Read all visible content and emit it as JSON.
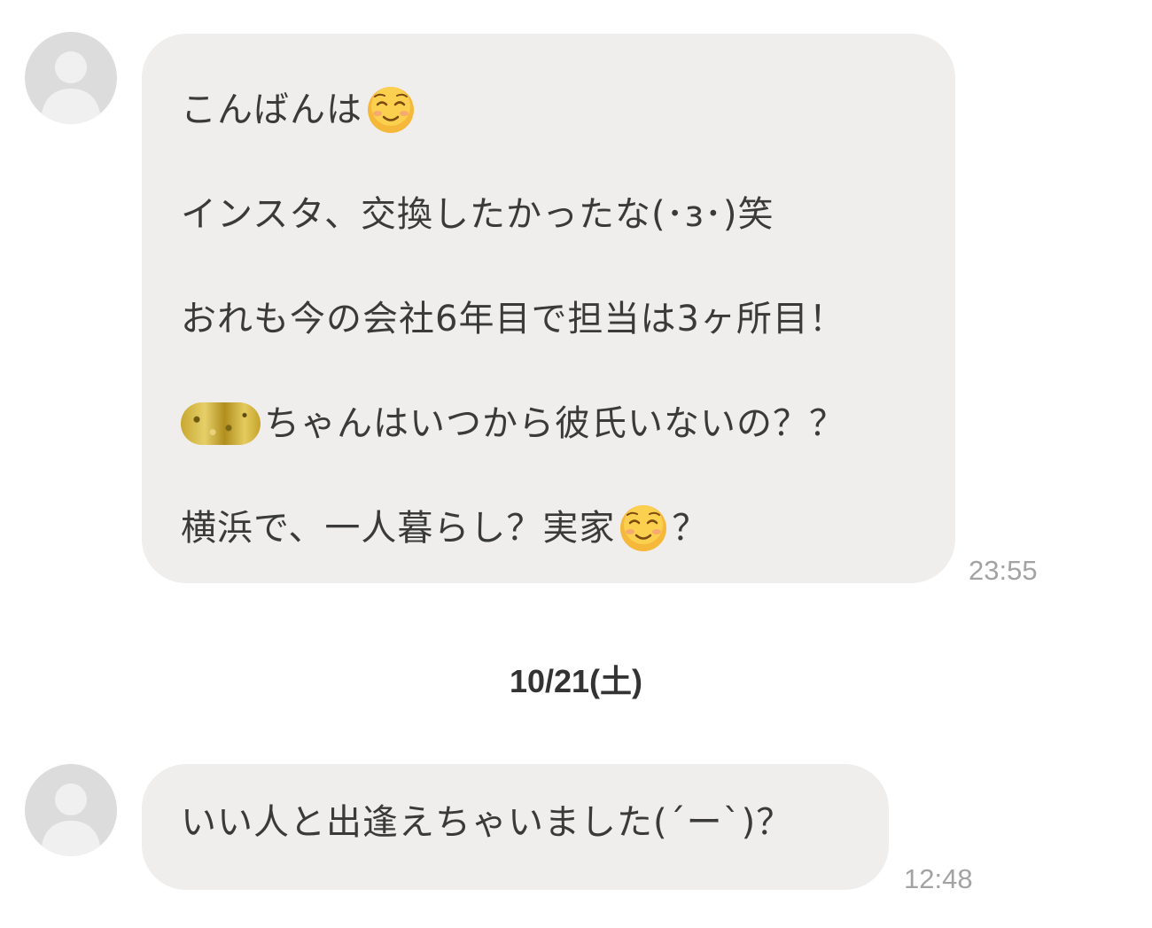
{
  "messages": [
    {
      "lines": [
        "こんばんは",
        "インスタ、交換したかったな(･з･)笑",
        "おれも今の会社6年目で担当は3ヶ所目！",
        "ちゃんはいつから彼氏いないの？？",
        "横浜で、一人暮らし？実家",
        "？"
      ],
      "time": "23:55"
    },
    {
      "lines": [
        "いい人と出逢えちゃいました(´ー`)？"
      ],
      "time": "12:48"
    }
  ],
  "date_separator": "10/21(土)",
  "icons": {
    "avatar": "default-person-avatar-icon",
    "emoji": "smiling-face-emoji-icon",
    "redacted": "redacted-name-blur"
  },
  "colors": {
    "bubble": "#efeeec",
    "avatar": "#dcdcdc",
    "timestamp": "#a3a3a3",
    "emoji": "#f5b83a"
  }
}
